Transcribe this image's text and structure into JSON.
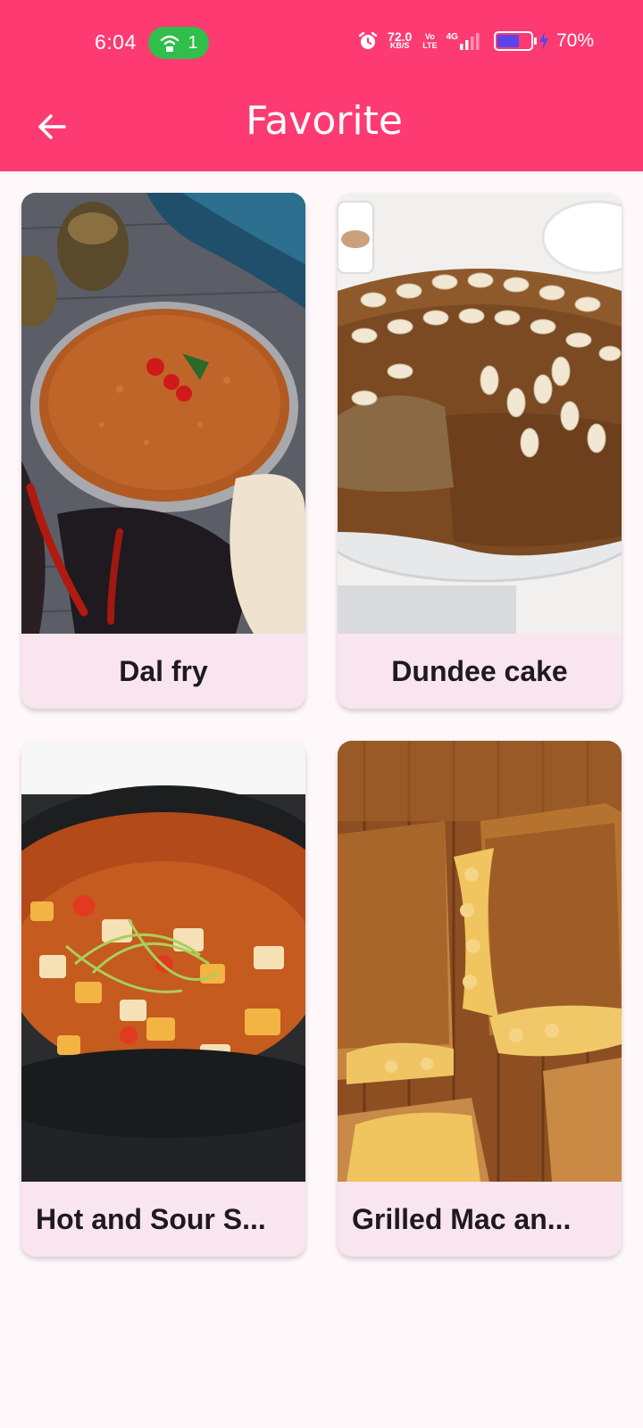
{
  "status_bar": {
    "time": "6:04",
    "hotspot_count": "1",
    "net_speed_value": "72.0",
    "net_speed_unit": "KB/S",
    "volte_top": "Vo",
    "volte_bottom": "LTE",
    "network_type": "4G",
    "battery_percent": "70%",
    "battery_level": 0.7,
    "colors": {
      "hotspot_pill": "#2fbf4a",
      "battery_fill": "#5b45e8"
    }
  },
  "app_bar": {
    "title": "Favorite",
    "back_icon": "arrow-left-icon",
    "background": "#fd3b72"
  },
  "favorites": [
    {
      "name": "Dal fry",
      "image": "dal-fry-photo"
    },
    {
      "name": "Dundee cake",
      "image": "dundee-cake-photo"
    },
    {
      "name": "Hot and Sour S...",
      "image": "hot-and-sour-soup-photo"
    },
    {
      "name": "Grilled Mac an...",
      "image": "grilled-mac-and-cheese-photo"
    }
  ],
  "theme": {
    "card_label_bg": "#f9e5ee",
    "page_bg": "#fff8fb"
  }
}
